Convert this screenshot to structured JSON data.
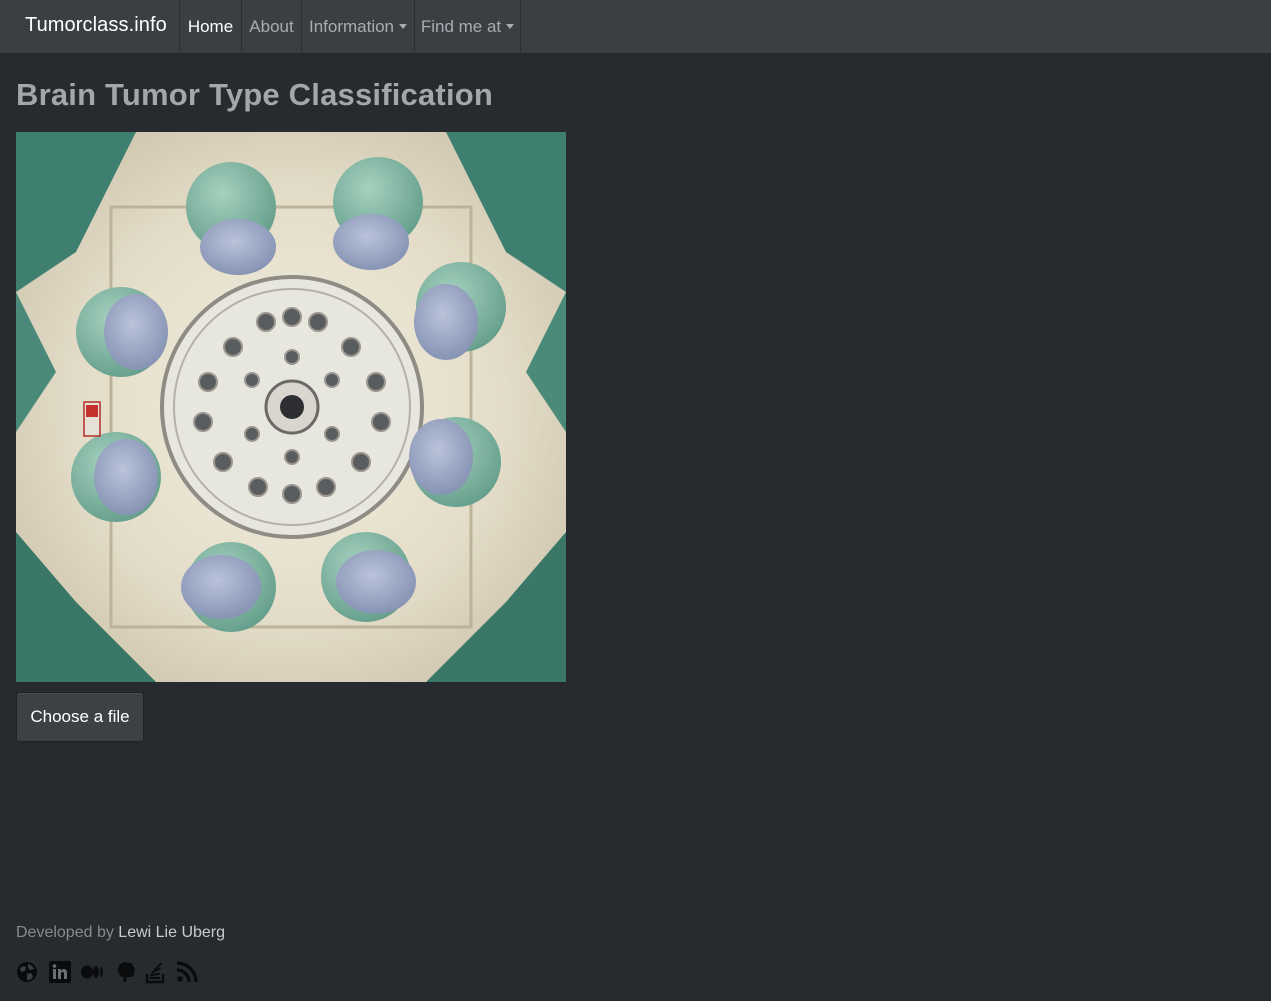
{
  "navbar": {
    "brand": "Tumorclass.info",
    "items": [
      {
        "label": "Home",
        "active": true
      },
      {
        "label": "About",
        "active": false
      },
      {
        "label": "Information",
        "dropdown": true
      },
      {
        "label": "Find me at",
        "dropdown": true
      }
    ]
  },
  "main": {
    "title": "Brain Tumor Type Classification",
    "image_icon": "surgeons-photo",
    "file_button_label": "Choose a file"
  },
  "footer": {
    "developed_by": "Developed by",
    "author": "Lewi Lie Uberg",
    "social_icons": [
      "globe-icon",
      "linkedin-icon",
      "medium-icon",
      "kaggle-icon",
      "stackoverflow-icon",
      "rss-icon"
    ]
  },
  "colors": {
    "background": "#272a2f",
    "navbar": "#3b3f44",
    "title": "#a3a6ab"
  }
}
